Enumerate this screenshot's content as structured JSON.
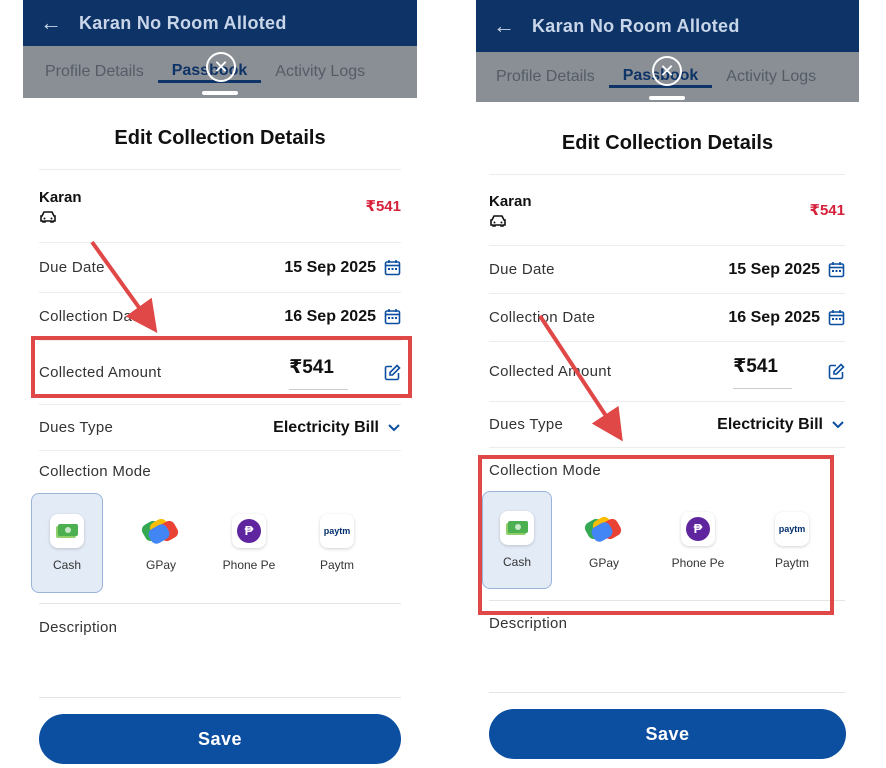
{
  "screens": [
    {
      "header": {
        "title": "Karan No Room Alloted"
      },
      "tabs": [
        "Profile Details",
        "Passbook",
        "Activity Logs"
      ],
      "sheet": {
        "title": "Edit Collection Details",
        "tenant": {
          "name": "Karan",
          "amount": "₹541"
        },
        "due_date": {
          "label": "Due Date",
          "value": "15 Sep 2025"
        },
        "collection_date": {
          "label": "Collection Date",
          "value": "16 Sep 2025"
        },
        "collected_amount": {
          "label": "Collected Amount",
          "value": "₹541"
        },
        "dues_type": {
          "label": "Dues Type",
          "value": "Electricity Bill"
        },
        "collection_mode": {
          "label": "Collection Mode",
          "selected": "Cash",
          "options": [
            "Cash",
            "GPay",
            "Phone Pe",
            "Paytm"
          ]
        },
        "description": {
          "label": "Description",
          "value": ""
        },
        "save_label": "Save"
      },
      "highlight": "collected-amount"
    },
    {
      "header": {
        "title": "Karan No Room Alloted"
      },
      "tabs": [
        "Profile Details",
        "Passbook",
        "Activity Logs"
      ],
      "sheet": {
        "title": "Edit Collection Details",
        "tenant": {
          "name": "Karan",
          "amount": "₹541"
        },
        "due_date": {
          "label": "Due Date",
          "value": "15 Sep 2025"
        },
        "collection_date": {
          "label": "Collection Date",
          "value": "16 Sep 2025"
        },
        "collected_amount": {
          "label": "Collected Amount",
          "value": "₹541"
        },
        "dues_type": {
          "label": "Dues Type",
          "value": "Electricity Bill"
        },
        "collection_mode": {
          "label": "Collection Mode",
          "selected": "Cash",
          "options": [
            "Cash",
            "GPay",
            "Phone Pe",
            "Paytm"
          ]
        },
        "description": {
          "label": "Description",
          "value": ""
        },
        "save_label": "Save"
      },
      "highlight": "collection-mode"
    }
  ],
  "paytm_logo_text": "paytm",
  "colors": {
    "appbar": "#0e3366",
    "accent": "#0c4fa0",
    "amount_red": "#d6203a",
    "highlight": "#e04848"
  }
}
